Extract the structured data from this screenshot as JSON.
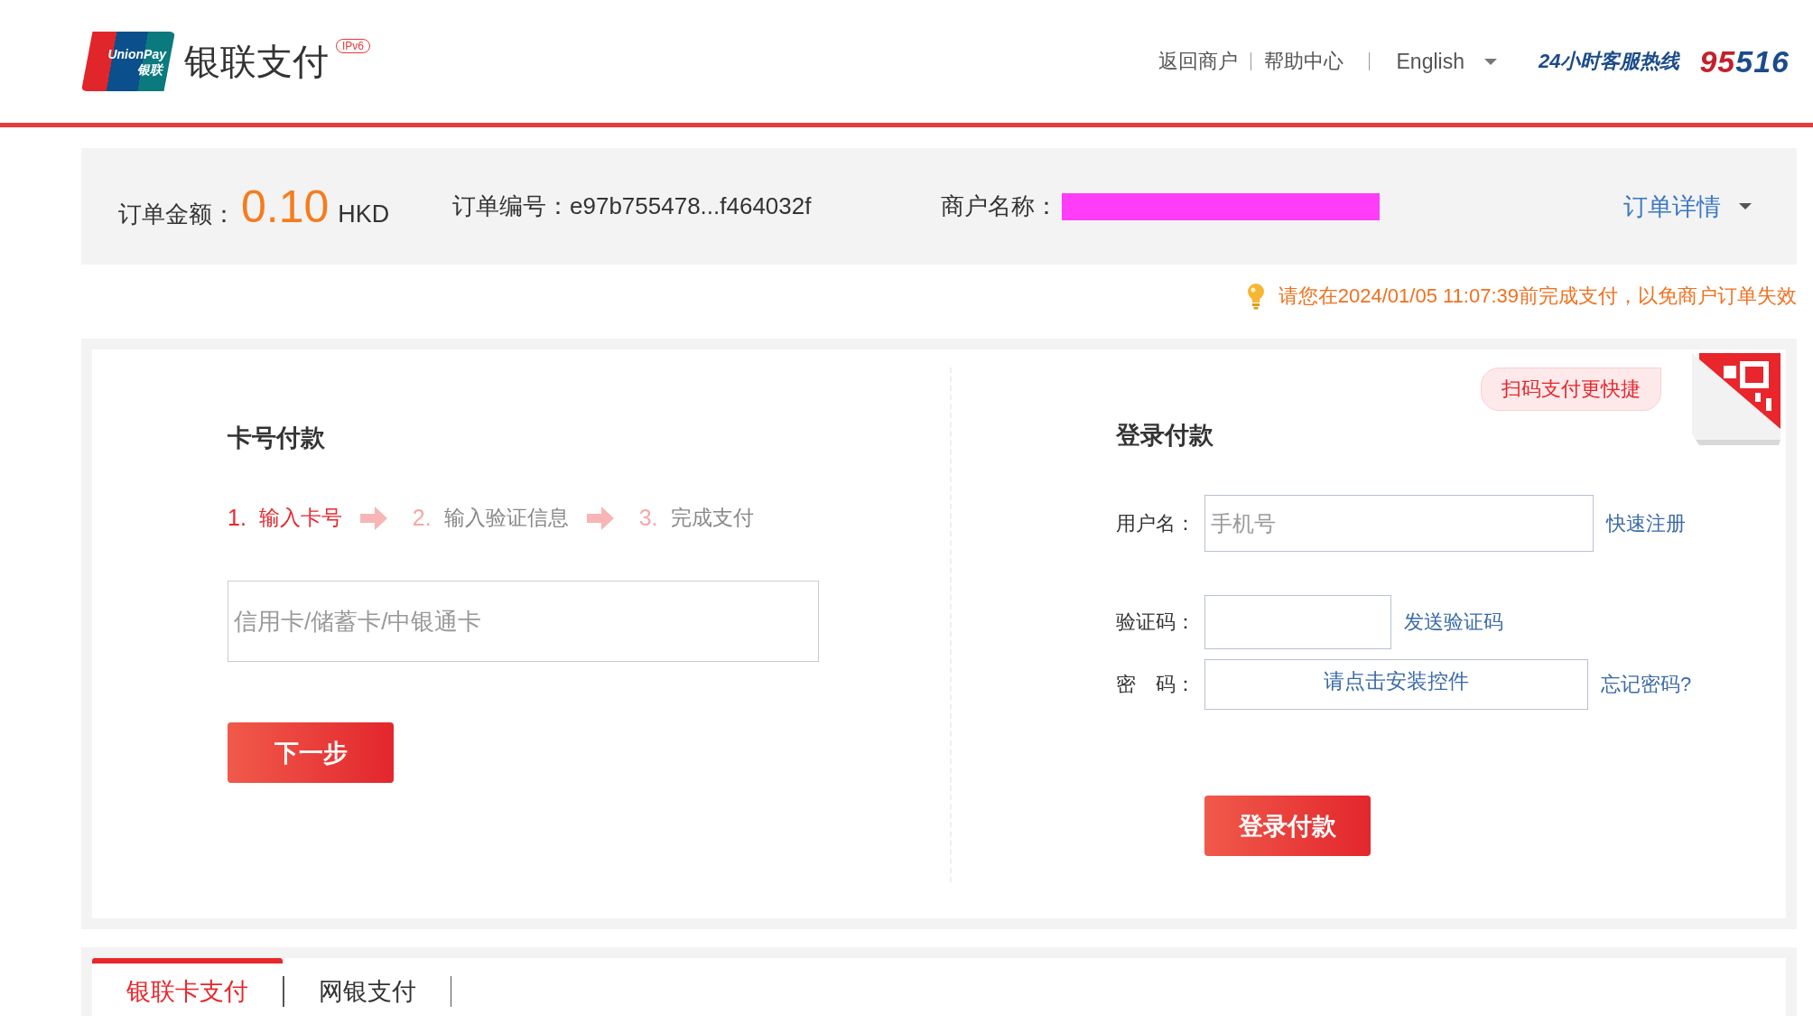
{
  "header": {
    "logo_top": "UnionPay",
    "logo_bottom": "银联",
    "title": "银联支付",
    "badge": "IPv6",
    "links": [
      {
        "label": "返回商户"
      },
      {
        "label": "帮助中心"
      }
    ],
    "language": "English",
    "hotline_label": "24小时客服热线",
    "hotline_number": "95516"
  },
  "order": {
    "amount_label": "订单金额：",
    "amount": "0.10",
    "currency": "HKD",
    "number_label": "订单编号：",
    "number": "e97b755478...f464032f",
    "merchant_label": "商户名称：",
    "details": "订单详情"
  },
  "deadline": "请您在2024/01/05 11:07:39前完成支付，以免商户订单失效",
  "card_pay": {
    "title": "卡号付款",
    "steps": [
      {
        "number": "1.",
        "label": "输入卡号",
        "selected": true
      },
      {
        "number": "2.",
        "label": "输入验证信息",
        "selected": false
      },
      {
        "number": "3.",
        "label": "完成支付",
        "selected": false
      }
    ],
    "card_field": {
      "placeholder": "信用卡/储蓄卡/中银通卡"
    },
    "next_button": "下一步"
  },
  "login_pay": {
    "title": "登录付款",
    "qr_tip": "扫码支付更快捷",
    "fields": [
      {
        "kind": "text",
        "label": "用户名：",
        "placeholder": "手机号",
        "link": "快速注册"
      },
      {
        "kind": "code",
        "label": "验证码：",
        "link": "发送验证码"
      },
      {
        "kind": "plugin",
        "label": "密　码：",
        "button": "请点击安装控件",
        "link": "忘记密码?"
      }
    ],
    "login_button": "登录付款"
  },
  "tabs": [
    {
      "label": "银联卡支付",
      "selected": true
    },
    {
      "label": "网银支付",
      "selected": false
    }
  ]
}
